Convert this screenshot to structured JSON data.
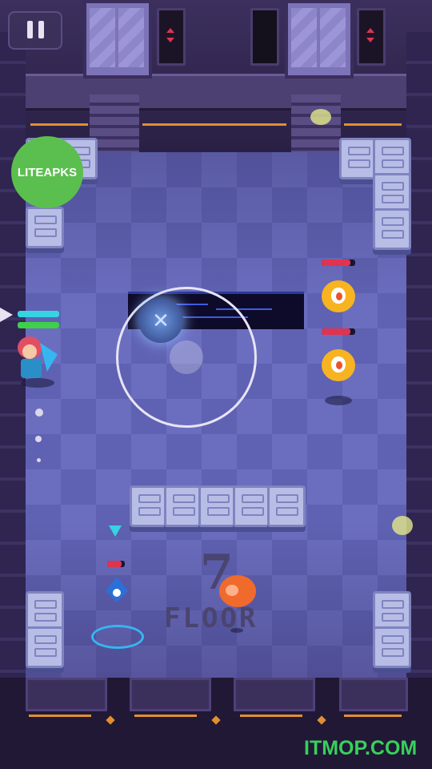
{
  "hud": {
    "pause_icon": "pause-icon"
  },
  "badge": {
    "text": "LITEAPKS"
  },
  "floor": {
    "number": "7",
    "label": "FLOOR"
  },
  "watermark": {
    "text": "ITMOP.COM"
  },
  "colors": {
    "health_green": "#3fcf4a",
    "shield_cyan": "#36d4e3",
    "enemy_hp": "#e0334f",
    "accent_orange": "#e0902f"
  },
  "hero": {
    "name": "hero-character"
  },
  "enemies": [
    {
      "type": "yellow-cyclops"
    },
    {
      "type": "yellow-cyclops"
    },
    {
      "type": "blue-drone"
    },
    {
      "type": "orange-blob"
    }
  ]
}
